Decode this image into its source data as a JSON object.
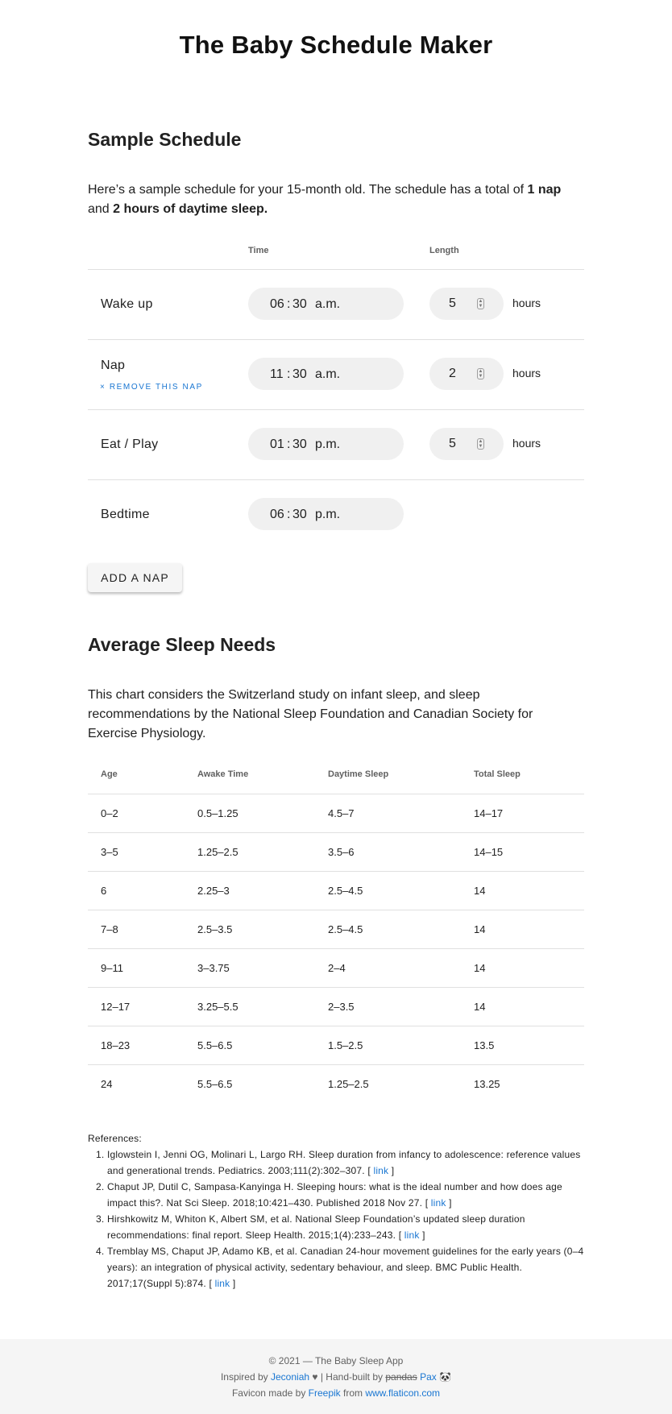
{
  "app": {
    "title": "The Baby Schedule Maker"
  },
  "schedule": {
    "heading": "Sample Schedule",
    "intro_pre": "Here’s a sample schedule for your 15-month old. The schedule has a total of ",
    "intro_naps": "1 nap",
    "intro_mid": " and ",
    "intro_sleep": "2 hours of daytime sleep.",
    "col_time": "Time",
    "col_length": "Length",
    "rows": [
      {
        "label": "Wake up",
        "hour": "06",
        "minute": "30",
        "ampm": "a.m.",
        "length": "5",
        "unit": "hours"
      },
      {
        "label": "Nap",
        "remove": "× Remove this nap",
        "hour": "11",
        "minute": "30",
        "ampm": "a.m.",
        "length": "2",
        "unit": "hours"
      },
      {
        "label": "Eat / Play",
        "hour": "01",
        "minute": "30",
        "ampm": "p.m.",
        "length": "5",
        "unit": "hours"
      },
      {
        "label": "Bedtime",
        "hour": "06",
        "minute": "30",
        "ampm": "p.m."
      }
    ],
    "add_nap": "ADD A NAP"
  },
  "needs": {
    "heading": "Average Sleep Needs",
    "intro": "This chart considers the Switzerland study on infant sleep, and sleep recommendations by the National Sleep Foundation and Canadian Society for Exercise Physiology.",
    "headers": [
      "Age",
      "Awake Time",
      "Daytime Sleep",
      "Total Sleep"
    ],
    "rows": [
      [
        "0–2",
        "0.5–1.25",
        "4.5–7",
        "14–17"
      ],
      [
        "3–5",
        "1.25–2.5",
        "3.5–6",
        "14–15"
      ],
      [
        "6",
        "2.25–3",
        "2.5–4.5",
        "14"
      ],
      [
        "7–8",
        "2.5–3.5",
        "2.5–4.5",
        "14"
      ],
      [
        "9–11",
        "3–3.75",
        "2–4",
        "14"
      ],
      [
        "12–17",
        "3.25–5.5",
        "2–3.5",
        "14"
      ],
      [
        "18–23",
        "5.5–6.5",
        "1.5–2.5",
        "13.5"
      ],
      [
        "24",
        "5.5–6.5",
        "1.25–2.5",
        "13.25"
      ]
    ]
  },
  "references": {
    "label": "References:",
    "link_text": "link",
    "items": [
      "Iglowstein I, Jenni OG, Molinari L, Largo RH. Sleep duration from infancy to adolescence: reference values and generational trends. Pediatrics. 2003;111(2):302–307.",
      "Chaput JP, Dutil C, Sampasa-Kanyinga H. Sleeping hours: what is the ideal number and how does age impact this?. Nat Sci Sleep. 2018;10:421–430. Published 2018 Nov 27.",
      "Hirshkowitz M, Whiton K, Albert SM, et al. National Sleep Foundation’s updated sleep duration recommendations: final report. Sleep Health. 2015;1(4):233–243.",
      "Tremblay MS, Chaput JP, Adamo KB, et al. Canadian 24-hour movement guidelines for the early years (0–4 years): an integration of physical activity, sedentary behaviour, and sleep. BMC Public Health. 2017;17(Suppl 5):874."
    ]
  },
  "footer": {
    "copyright": "© 2021 — The Baby Sleep App",
    "inspired_pre": "Inspired by ",
    "inspired_name": "Jeconiah",
    "heart": "♥",
    "handbuilt_pre": " | Hand-built by ",
    "struck": "pandas",
    "author": "Pax",
    "panda": "🐼",
    "favicon_pre": "Favicon made by ",
    "favicon_author": "Freepik",
    "favicon_mid": " from ",
    "favicon_site": "www.flaticon.com"
  }
}
